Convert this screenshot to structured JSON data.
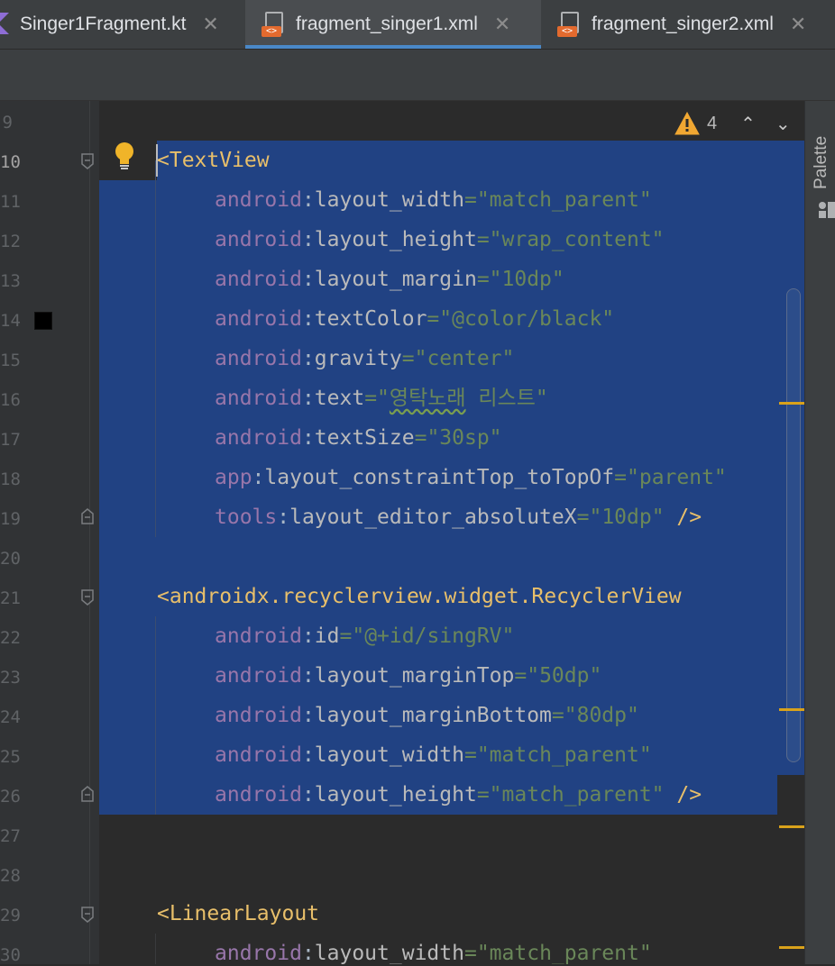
{
  "tabs": [
    {
      "label": "Singer1Fragment.kt",
      "icon": "kotlin-file-icon",
      "active": false
    },
    {
      "label": "fragment_singer1.xml",
      "icon": "xml-file-icon",
      "active": true
    },
    {
      "label": "fragment_singer2.xml",
      "icon": "xml-file-icon",
      "active": false
    }
  ],
  "tab_close_glyph": "✕",
  "inspection": {
    "warning_count": "4",
    "icon": "warning-triangle-icon",
    "prev": "⌃",
    "next": "⌄"
  },
  "gutter": {
    "line_numbers": [
      "9",
      "10",
      "11",
      "12",
      "13",
      "14",
      "15",
      "16",
      "17",
      "18",
      "19",
      "20",
      "21",
      "22",
      "23",
      "24",
      "25",
      "26",
      "27",
      "28",
      "29",
      "30"
    ],
    "current_line": "10"
  },
  "code": {
    "textview_open": "<TextView",
    "lines": [
      {
        "ns": "android",
        "attr": "layout_width",
        "val": "\"match_parent\""
      },
      {
        "ns": "android",
        "attr": "layout_height",
        "val": "\"wrap_content\""
      },
      {
        "ns": "android",
        "attr": "layout_margin",
        "val": "\"10dp\""
      },
      {
        "ns": "android",
        "attr": "textColor",
        "val": "\"@color/black\""
      },
      {
        "ns": "android",
        "attr": "gravity",
        "val": "\"center\""
      },
      {
        "ns": "android",
        "attr": "text",
        "val_open": "\"",
        "val_korean": "영탁노래",
        "val_rest": " 리스트\""
      },
      {
        "ns": "android",
        "attr": "textSize",
        "val": "\"30sp\""
      },
      {
        "ns": "app",
        "attr": "layout_constraintTop_toTopOf",
        "val": "\"parent\""
      },
      {
        "ns": "tools",
        "attr": "layout_editor_absoluteX",
        "val": "\"10dp\"",
        "close": " />"
      }
    ],
    "recycler_open": "<androidx.recyclerview.widget.RecyclerView",
    "recycler_lines": [
      {
        "ns": "android",
        "attr": "id",
        "val": "\"@+id/singRV\""
      },
      {
        "ns": "android",
        "attr": "layout_marginTop",
        "val": "\"50dp\""
      },
      {
        "ns": "android",
        "attr": "layout_marginBottom",
        "val": "\"80dp\""
      },
      {
        "ns": "android",
        "attr": "layout_width",
        "val": "\"match_parent\""
      },
      {
        "ns": "android",
        "attr": "layout_height",
        "val": "\"match_parent\"",
        "close": " />"
      }
    ],
    "linear_open": "<LinearLayout",
    "linear_lines": [
      {
        "ns": "android",
        "attr": "layout_width",
        "val": "\"match_parent\""
      }
    ]
  },
  "side_panel": {
    "label": "Palette",
    "icon": "palette-icon"
  },
  "colors": {
    "editor_bg": "#2b2b2b",
    "selection": "#214283",
    "tag": "#e8bf6a",
    "namespace": "#9876aa",
    "attribute": "#bababa",
    "value": "#6a8759",
    "accent": "#4a88c7",
    "warning": "#d9a21b"
  }
}
